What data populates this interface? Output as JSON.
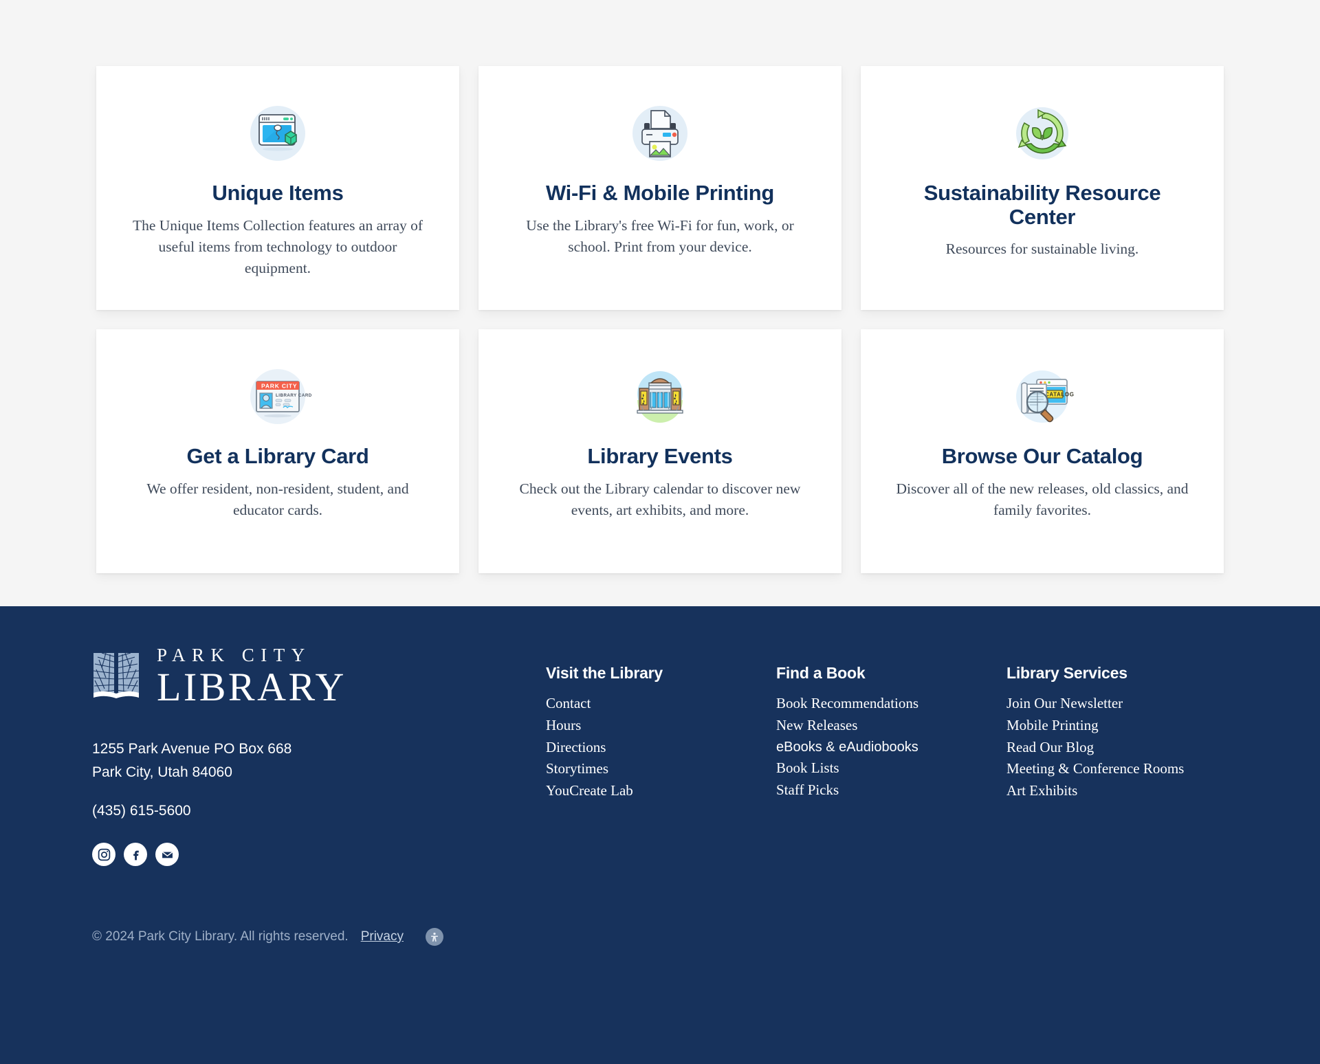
{
  "theme": {
    "page_bg": "#f5f5f5",
    "card_bg": "#ffffff",
    "navy": "#12315c",
    "footer_bg": "#17325c",
    "body_text": "#3f4a5a",
    "muted": "#9fb0c8"
  },
  "cards": [
    {
      "icon": "unique-items-icon",
      "title": "Unique Items",
      "desc": "The Unique Items Collection features an array of useful items from technology to outdoor equipment."
    },
    {
      "icon": "printer-icon",
      "title": "Wi-Fi & Mobile Printing",
      "desc": "Use the Library's free Wi-Fi for fun, work, or school.  Print from your device."
    },
    {
      "icon": "recycle-leaf-icon",
      "title": "Sustainability Resource Center",
      "desc": "Resources for sustainable living."
    },
    {
      "icon": "library-card-icon",
      "title": "Get a Library Card",
      "desc": "We offer resident, non-resident, student, and educator cards."
    },
    {
      "icon": "library-building-icon",
      "title": "Library Events",
      "desc": "Check out the Library calendar to discover new events, art exhibits, and more."
    },
    {
      "icon": "catalog-search-icon",
      "title": "Browse Our Catalog",
      "desc": "Discover all of the new releases, old classics, and family favorites."
    }
  ],
  "footer": {
    "logo": {
      "line1": "PARK CITY",
      "line2": "LIBRARY",
      "mark": "open-book-leaf-icon"
    },
    "address_line1": "1255 Park Avenue PO Box 668",
    "address_line2": "Park City, Utah 84060",
    "phone": "(435) 615-5600",
    "social": [
      {
        "name": "instagram-icon",
        "label": "Instagram"
      },
      {
        "name": "facebook-icon",
        "label": "Facebook"
      },
      {
        "name": "email-icon",
        "label": "Email"
      }
    ],
    "columns": [
      {
        "title": "Visit the Library",
        "links": [
          "Contact",
          "Hours",
          "Directions",
          "Storytimes",
          "YouCreate Lab"
        ]
      },
      {
        "title": "Find a Book",
        "links": [
          "Book Recommendations",
          "New Releases",
          "eBooks & eAudiobooks",
          "Book Lists",
          "Staff Picks"
        ]
      },
      {
        "title": "Library Services",
        "links": [
          "Join Our Newsletter",
          "Mobile Printing",
          "Read Our Blog",
          "Meeting & Conference Rooms",
          "Art Exhibits"
        ]
      }
    ],
    "copyright": "© 2024 Park City Library. All rights reserved.",
    "privacy_label": "Privacy",
    "accessibility_icon": "accessibility-icon"
  }
}
